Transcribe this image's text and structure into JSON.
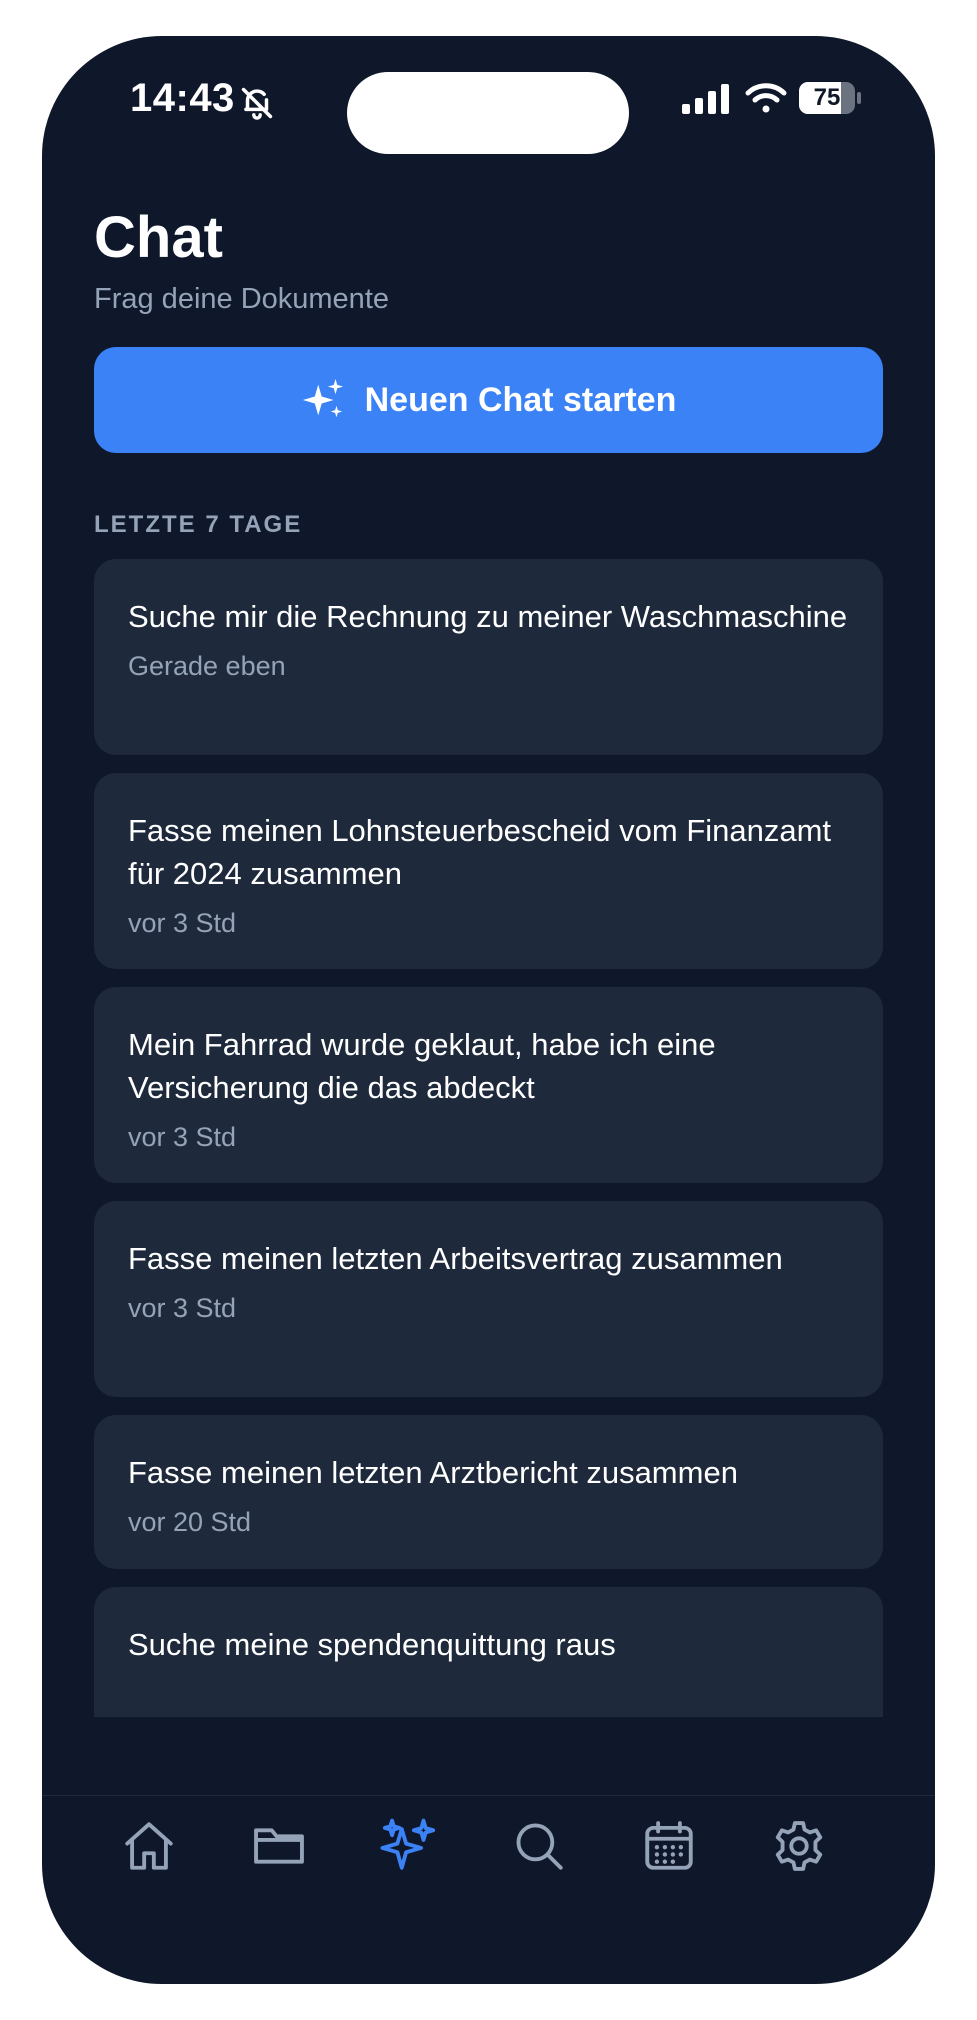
{
  "status_bar": {
    "time": "14:43",
    "battery_level": "75",
    "battery_fraction": 0.75,
    "icons": [
      "bell-off-icon",
      "cellular-signal-icon",
      "wifi-icon",
      "battery-icon"
    ]
  },
  "header": {
    "title": "Chat",
    "subtitle": "Frag deine Dokumente"
  },
  "new_chat_button": {
    "label": "Neuen Chat starten",
    "icon": "sparkles-icon"
  },
  "section": {
    "label": "LETZTE 7 TAGE"
  },
  "chats": [
    {
      "title": "Suche mir die Rechnung zu meiner Waschmaschine",
      "time": "Gerade eben"
    },
    {
      "title": "Fasse meinen Lohnsteuerbescheid vom Finanzamt für 2024 zusammen",
      "time": "vor 3 Std"
    },
    {
      "title": "Mein Fahrrad wurde geklaut, habe ich eine Versicherung die das abdeckt",
      "time": "vor 3 Std"
    },
    {
      "title": "Fasse meinen letzten Arbeitsvertrag zusammen",
      "time": "vor 3 Std"
    },
    {
      "title": "Fasse meinen letzten Arztbericht zusammen",
      "time": "vor 20 Std"
    },
    {
      "title": "Suche meine spendenquittung raus",
      "time": ""
    }
  ],
  "tabs": [
    {
      "name": "home",
      "icon": "home-icon",
      "active": false
    },
    {
      "name": "documents",
      "icon": "folder-icon",
      "active": false
    },
    {
      "name": "chat",
      "icon": "sparkles-icon",
      "active": true
    },
    {
      "name": "search",
      "icon": "search-icon",
      "active": false
    },
    {
      "name": "calendar",
      "icon": "calendar-icon",
      "active": false
    },
    {
      "name": "settings",
      "icon": "gear-icon",
      "active": false
    }
  ],
  "colors": {
    "background": "#0f172a",
    "card": "#1e293b",
    "accent": "#3b82f6",
    "muted_text": "#94a3b8",
    "icon_inactive": "#94a3b8"
  }
}
